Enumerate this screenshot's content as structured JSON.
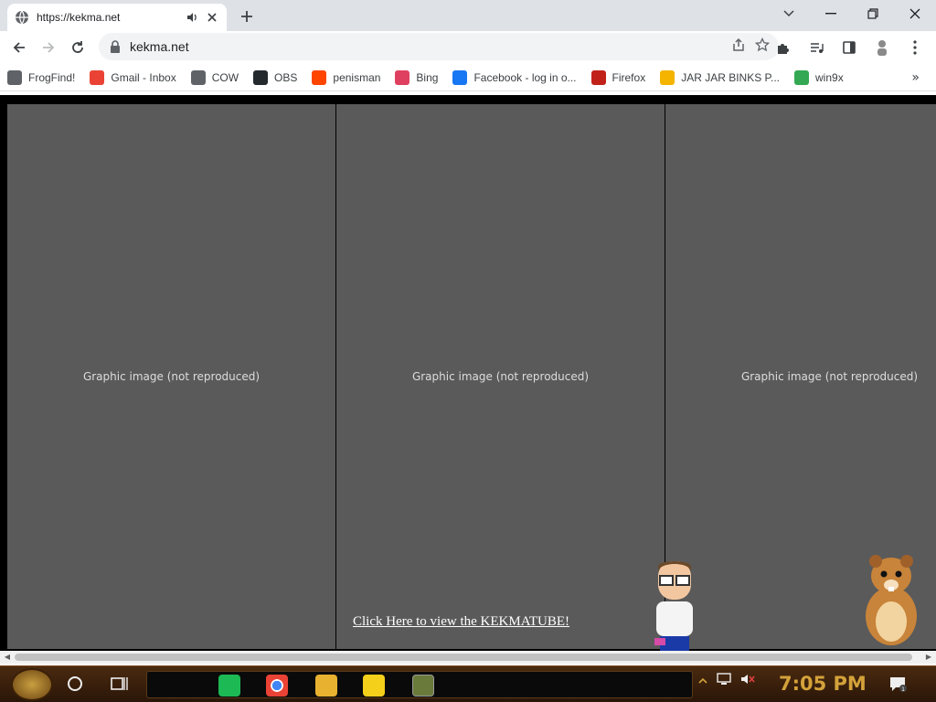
{
  "tab": {
    "title": "https://kekma.net"
  },
  "address_bar": {
    "url": "kekma.net"
  },
  "bookmarks": [
    {
      "label": "FrogFind!",
      "icon": "globe-icon",
      "color": "#5f6368"
    },
    {
      "label": "Gmail - Inbox",
      "icon": "gmail-icon",
      "color": "#ea4335"
    },
    {
      "label": "COW",
      "icon": "globe-icon",
      "color": "#5f6368"
    },
    {
      "label": "OBS",
      "icon": "github-icon",
      "color": "#24292e"
    },
    {
      "label": "penisman",
      "icon": "reddit-icon",
      "color": "#ff4500"
    },
    {
      "label": "Bing",
      "icon": "bing-icon",
      "color": "#e04060"
    },
    {
      "label": "Facebook - log in o...",
      "icon": "facebook-icon",
      "color": "#1877f2"
    },
    {
      "label": "Firefox",
      "icon": "firefox-icon",
      "color": "#c0221a"
    },
    {
      "label": "JAR JAR BINKS P...",
      "icon": "shopping-bag-icon",
      "color": "#f4b400"
    },
    {
      "label": "win9x",
      "icon": "chrome-icon",
      "color": "#34a853"
    }
  ],
  "page": {
    "link_text": "Click Here to view the KEKMATUBE!",
    "image_placeholder": "Graphic image (not reproduced)"
  },
  "taskbar": {
    "clock": "7:05 PM",
    "notification_count": "1",
    "accent_color": "#d4a23a"
  }
}
